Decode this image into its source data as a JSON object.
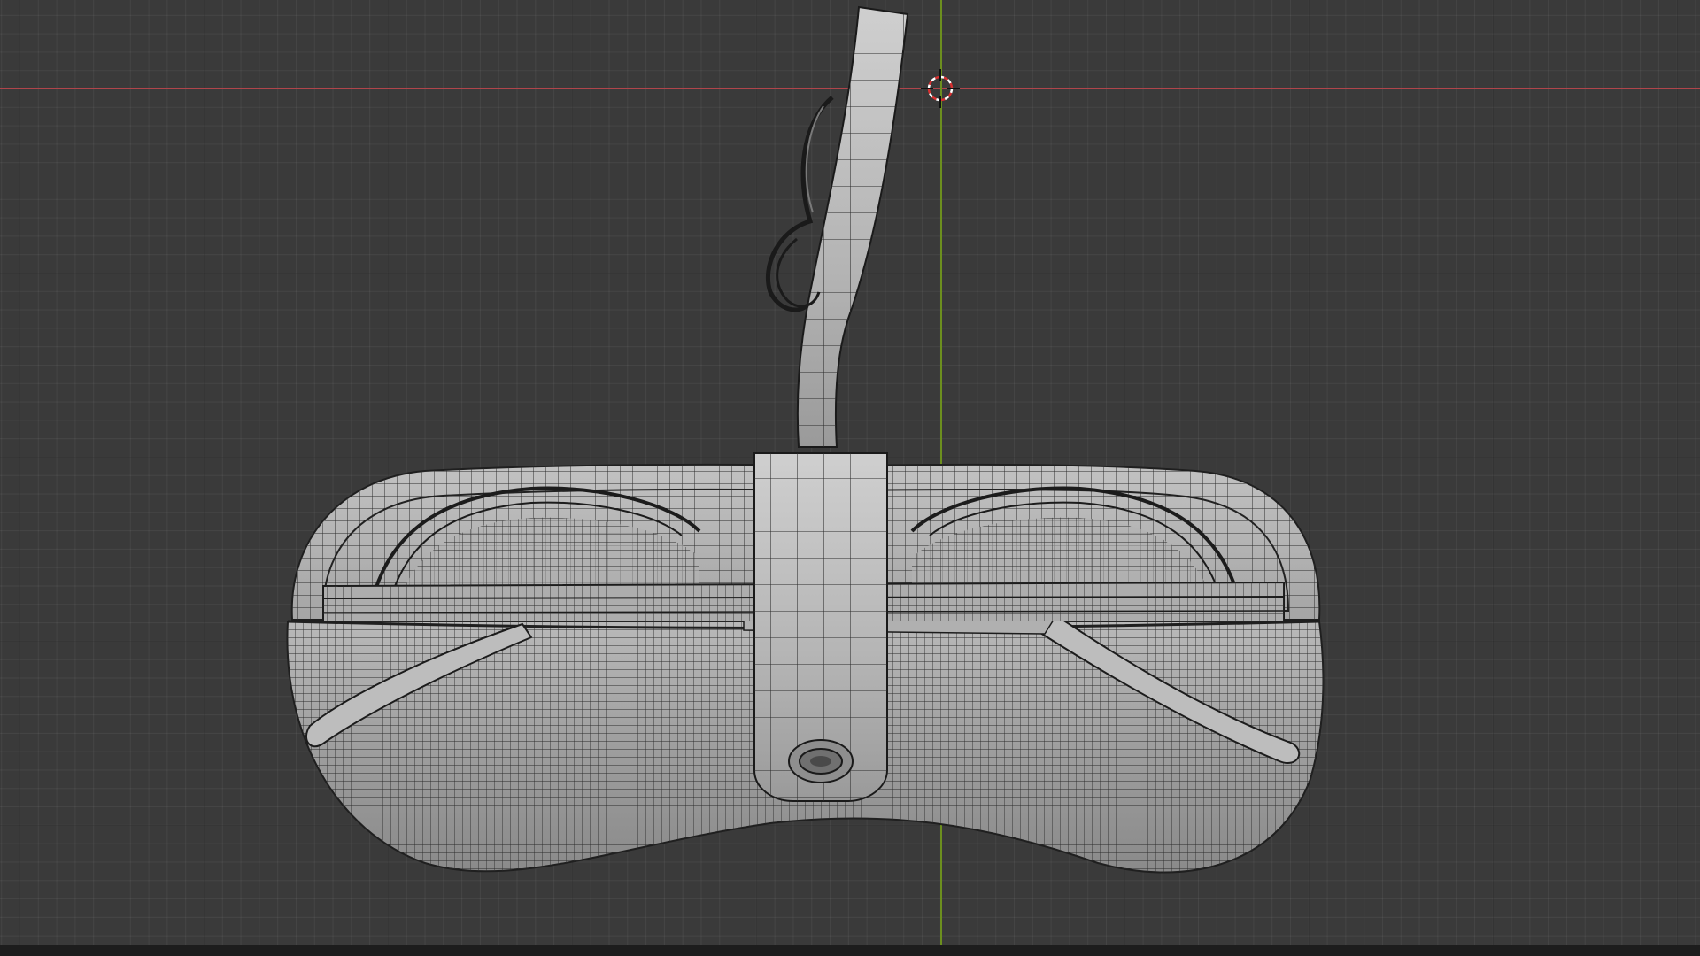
{
  "viewport": {
    "background_color": "#3a3a3a",
    "grid_major_color": "#2f2f2f",
    "grid_minor_color": "#444444"
  },
  "axes": {
    "x_axis_color": "#b0454b",
    "y_axis_color": "#6c8f1e"
  },
  "cursor": {
    "icon": "3d-cursor-icon",
    "colors": [
      "#ffffff",
      "#d83030"
    ]
  },
  "model": {
    "name": "",
    "mode": "wireframe-overlay",
    "shade_color": "#a8a8a8",
    "wire_color": "#2a2a2a"
  }
}
